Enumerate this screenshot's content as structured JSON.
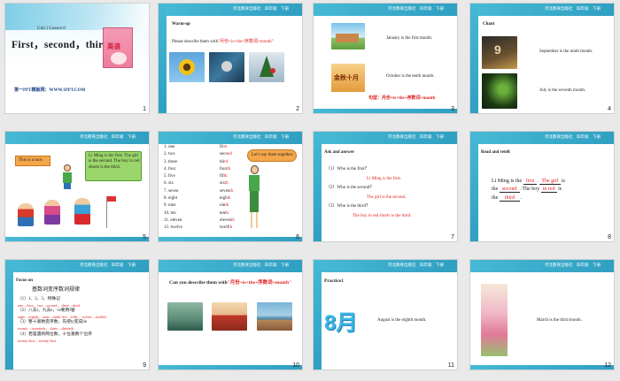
{
  "header_text": "河北教育出版社　四年级　下册",
  "slides": [
    {
      "num": "1",
      "unit": "Unit 2 Lesson 8",
      "title": "First，second，third.",
      "book_label": "英语",
      "site": "第一PPT模板网：WWW.1PPT.COM"
    },
    {
      "num": "2",
      "section": "Warm-up",
      "prompt_black": "Please describe them with",
      "prompt_red": "\"月份+is+the+序数词+month\""
    },
    {
      "num": "3",
      "line1": "January is the first month.",
      "line2": "October is the tenth month.",
      "pic2_text": "金秋十月",
      "pattern": "句型：月份+is+the+序数词+month"
    },
    {
      "num": "4",
      "section": "Chant",
      "line1": "September is the ninth month.",
      "line2": "July is the seventh month."
    },
    {
      "num": "5",
      "bubble_left": "This is a race.",
      "bubble_right": "Li Ming is the first. The girl is the second. The boy in red shorts is the third."
    },
    {
      "num": "6",
      "cardinals": [
        "1.  one",
        "2.  two",
        "3.  three",
        "4.  four",
        "5.  five",
        "6.  six",
        "7.  seven",
        "8.  eight",
        "9.  nine",
        "10.  ten",
        "11.  eleven",
        "12.  twelve"
      ],
      "ordinal_stems": [
        "fir",
        "seco",
        "thi",
        "four",
        "fif",
        "six",
        "seven",
        "eigh",
        "nin",
        "tent",
        "eleven",
        "twelf"
      ],
      "ordinal_ends": [
        "st",
        "nd",
        "rd",
        "th",
        "th",
        "th",
        "th",
        "th",
        "th",
        "h",
        "th",
        "th"
      ],
      "bubble": "Let's say them together."
    },
    {
      "num": "7",
      "section": "Ask and answer",
      "q1": "（1）Who is the first？",
      "a1": "Li Ming is the first.",
      "q2": "（2）Who is the second？",
      "a2": "The girl is the second.",
      "q3": "（3）Who is the third？",
      "a3": "The boy in red shorts is the third."
    },
    {
      "num": "8",
      "section": "Read and retell",
      "p1": "Li Ming  is  the",
      "b1": "first",
      "p2": ".",
      "b2": "The girl",
      "p3": " is",
      "p4": "the",
      "b3": "second",
      "p5": ". The boy",
      "b4": "in red",
      "p6": "is",
      "p7": "the",
      "b5": "third",
      "p8": "."
    },
    {
      "num": "9",
      "section": "Focus on",
      "heading": "基数词变序数词规律",
      "rules": [
        "（1）1、2、3，特殊记",
        "one→first，  two→second，  three→third",
        "（2）八去t，九去e，ve要用f替",
        "eight→eighth， nine→ninth five→fifth， twelve→twelfth",
        "（3）整十基数变序数，先把ty变成tie",
        "twenty→twentieth，  thirty→thirtieth",
        "（4）若是遇到两位数，十位基数个位序",
        "twenty-first→twenty-first"
      ]
    },
    {
      "num": "10",
      "prompt_black": "Can you describe them with",
      "prompt_red": "\"月份+is+the+序数词+month\""
    },
    {
      "num": "11",
      "section": "Practice1",
      "big": "8月",
      "line": "August is the eighth month."
    },
    {
      "num": "12",
      "line": "March is the third month."
    }
  ]
}
